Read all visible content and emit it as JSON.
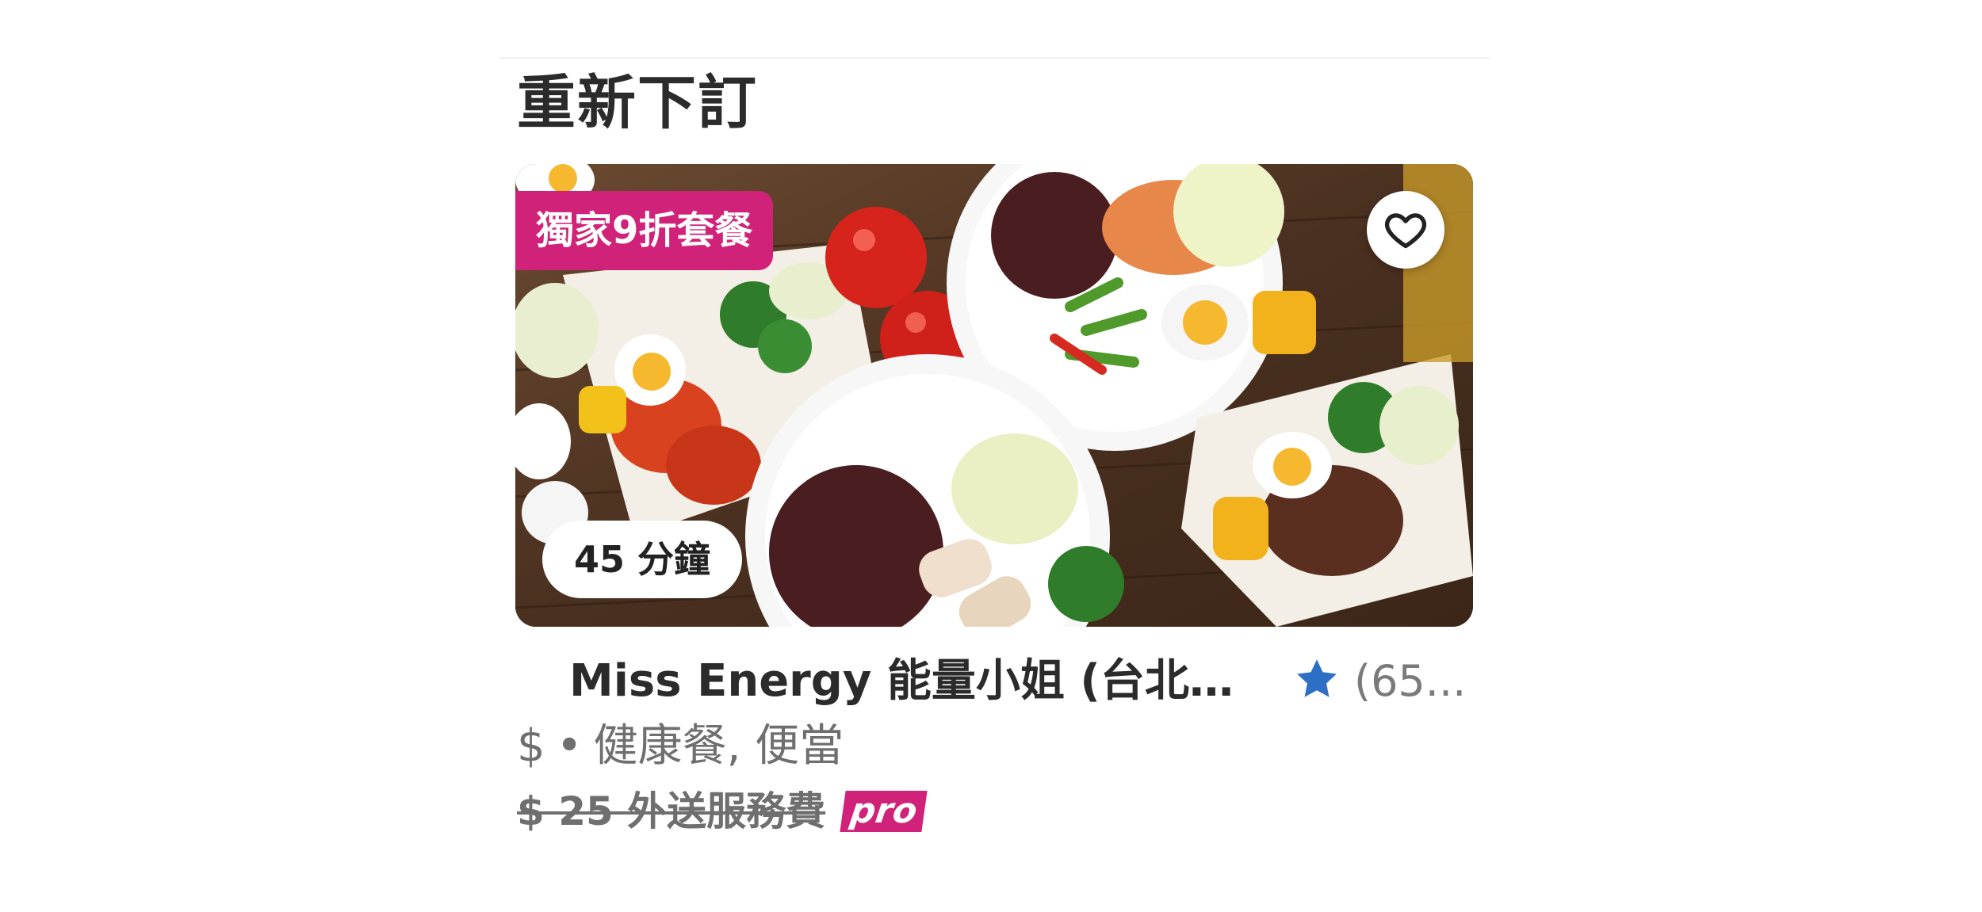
{
  "section": {
    "title": "重新下訂"
  },
  "card": {
    "promo_badge": "獨家9折套餐",
    "delivery_time": "45 分鐘",
    "favorite_icon": "heart-outline-icon",
    "store_name": "Miss Energy 能量小姐 (台北錦...",
    "rating_icon": "star-icon",
    "rating_count": "(65...",
    "price_level": "$",
    "separator": "•",
    "cuisines": "健康餐, 便當",
    "delivery_fee": "$ 25 外送服務費",
    "pro_badge": "pro"
  },
  "colors": {
    "brand_pink": "#d1227a",
    "star_blue": "#2c6fc4",
    "title_text": "#2b2b2b",
    "muted_text": "#6f6f6f"
  }
}
